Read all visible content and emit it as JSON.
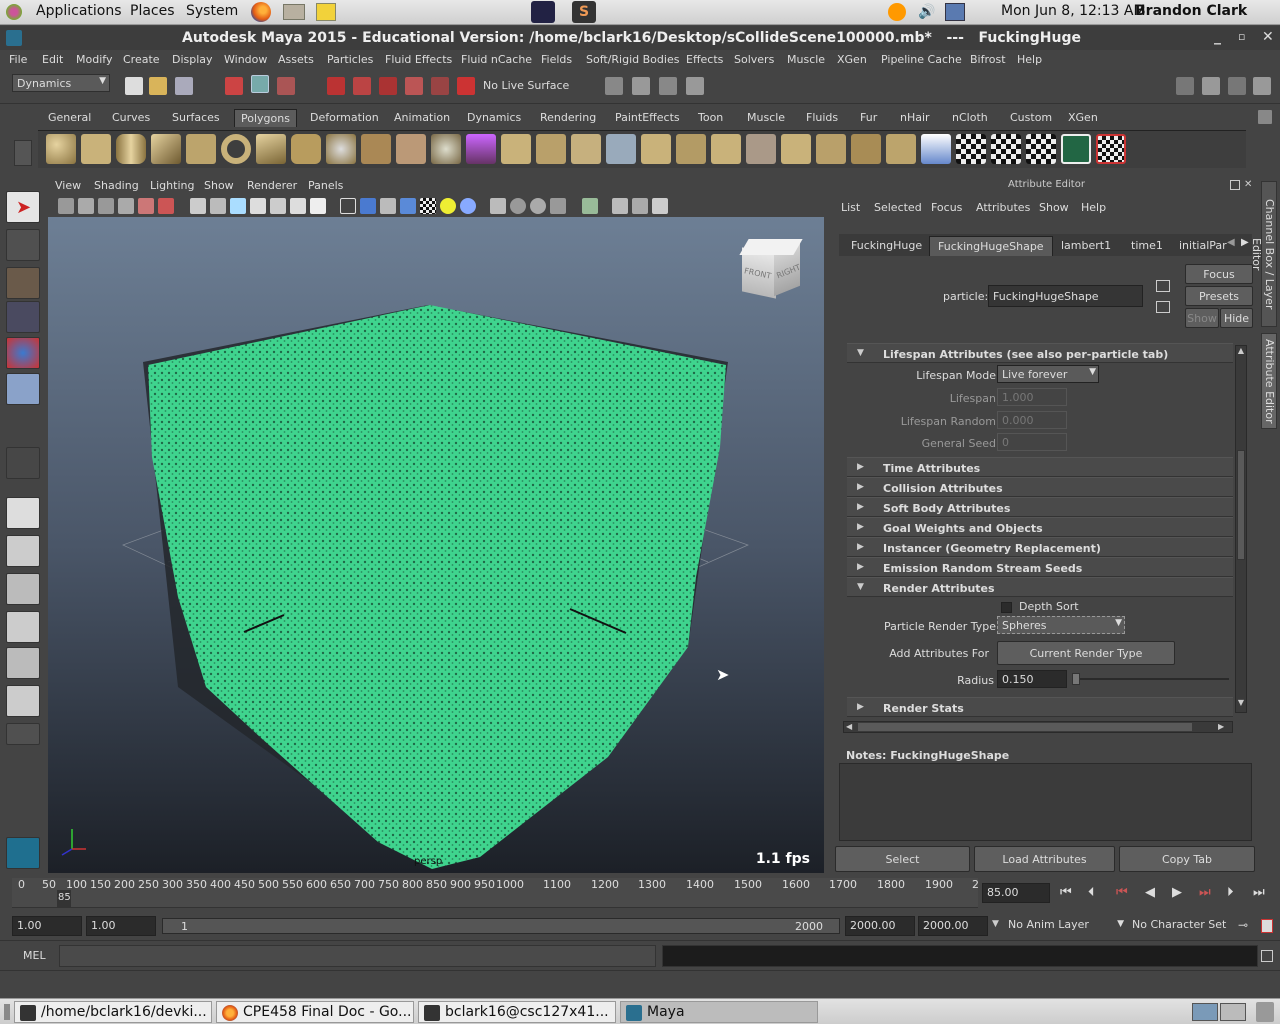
{
  "top_panel": {
    "applications": "Applications",
    "places": "Places",
    "system": "System",
    "clock": "Mon Jun  8, 12:13 AM",
    "user": "Brandon Clark"
  },
  "window_title": "Autodesk Maya 2015 - Educational Version: /home/bclark16/Desktop/sCollideScene100000.mb*   ---   FuckingHuge",
  "menu": [
    "File",
    "Edit",
    "Modify",
    "Create",
    "Display",
    "Window",
    "Assets",
    "Particles",
    "Fluid Effects",
    "Fluid nCache",
    "Fields",
    "Soft/Rigid Bodies",
    "Effects",
    "Solvers",
    "Muscle",
    "XGen",
    "Pipeline Cache",
    "Bifrost",
    "Help"
  ],
  "status_line": {
    "menu_set": "Dynamics",
    "live_surface": "No Live Surface"
  },
  "shelf_tabs": [
    "General",
    "Curves",
    "Surfaces",
    "Polygons",
    "Deformation",
    "Animation",
    "Dynamics",
    "Rendering",
    "PaintEffects",
    "Toon",
    "Muscle",
    "Fluids",
    "Fur",
    "nHair",
    "nCloth",
    "Custom",
    "XGen"
  ],
  "shelf_active": "Polygons",
  "viewport": {
    "menu": [
      "View",
      "Shading",
      "Lighting",
      "Show",
      "Renderer",
      "Panels"
    ],
    "fps": "1.1 fps",
    "camera": "persp",
    "viewcube_front": "FRONT",
    "viewcube_right": "RIGHT"
  },
  "attribute_editor": {
    "title": "Attribute Editor",
    "menu": [
      "List",
      "Selected",
      "Focus",
      "Attributes",
      "Show",
      "Help"
    ],
    "tabs": [
      "FuckingHuge",
      "FuckingHugeShape",
      "lambert1",
      "time1",
      "initialPar"
    ],
    "active_tab": "FuckingHugeShape",
    "particle_label": "particle:",
    "particle_name": "FuckingHugeShape",
    "buttons": {
      "focus": "Focus",
      "presets": "Presets",
      "show": "Show",
      "hide": "Hide"
    },
    "sections": {
      "lifespan": "Lifespan Attributes (see also per-particle tab)",
      "time": "Time Attributes",
      "collision": "Collision Attributes",
      "soft_body": "Soft Body Attributes",
      "goal": "Goal Weights and Objects",
      "instancer": "Instancer (Geometry Replacement)",
      "emission": "Emission Random Stream Seeds",
      "render": "Render Attributes",
      "render_stats": "Render Stats"
    },
    "lifespan_fields": {
      "mode_label": "Lifespan Mode",
      "mode_value": "Live forever",
      "lifespan_label": "Lifespan",
      "lifespan_value": "1.000",
      "random_label": "Lifespan Random",
      "random_value": "0.000",
      "seed_label": "General Seed",
      "seed_value": "0"
    },
    "render_fields": {
      "depth_sort": "Depth Sort",
      "render_type_label": "Particle Render Type",
      "render_type_value": "Spheres",
      "add_attr_label": "Add Attributes For",
      "add_attr_button": "Current Render Type",
      "radius_label": "Radius",
      "radius_value": "0.150"
    },
    "notes_label": "Notes:  FuckingHugeShape",
    "bottom_buttons": [
      "Select",
      "Load Attributes",
      "Copy Tab"
    ]
  },
  "side_tabs": [
    "Channel Box / Layer Editor",
    "Attribute Editor"
  ],
  "time_slider": {
    "ticks": [
      "0",
      "50",
      "100",
      "150",
      "200",
      "250",
      "300",
      "350",
      "400",
      "450",
      "500",
      "550",
      "600",
      "650",
      "700",
      "750",
      "800",
      "850",
      "900",
      "950",
      "1000",
      "1100",
      "1200",
      "1300",
      "1400",
      "1500",
      "1600",
      "1700",
      "1800",
      "1900",
      "2"
    ],
    "current_frame_marker": "85",
    "current_time": "85.00"
  },
  "range_slider": {
    "start_time": "1.00",
    "playback_start": "1.00",
    "range_start": "1",
    "range_end": "2000",
    "playback_end": "2000.00",
    "end_time": "2000.00",
    "anim_layer": "No Anim Layer",
    "character_set": "No Character Set"
  },
  "command_line": {
    "label": "MEL"
  },
  "taskbar": [
    {
      "label": "/home/bclark16/devki..."
    },
    {
      "label": "CPE458 Final Doc - Go..."
    },
    {
      "label": "bclark16@csc127x41..."
    },
    {
      "label": "Maya"
    }
  ]
}
